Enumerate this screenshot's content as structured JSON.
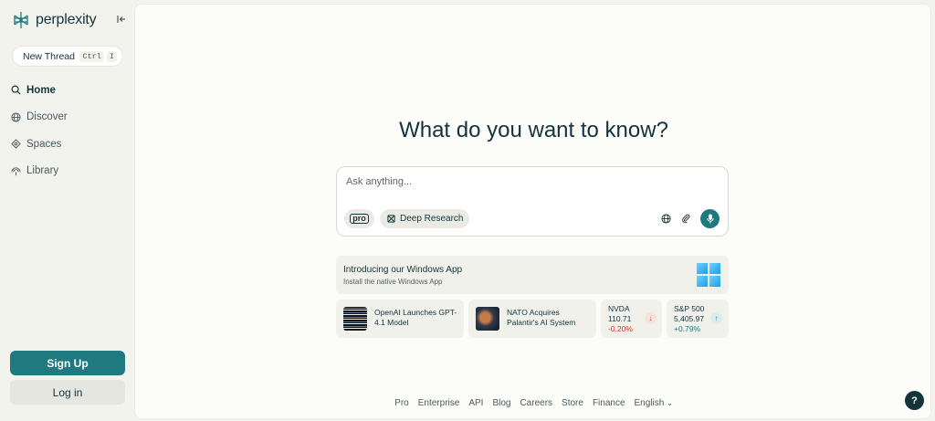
{
  "app": {
    "name": "perplexity"
  },
  "sidebar": {
    "new_thread": {
      "label": "New Thread",
      "shortcut_key1": "Ctrl",
      "shortcut_key2": "I"
    },
    "nav": [
      {
        "label": "Home",
        "icon": "search-icon",
        "active": true
      },
      {
        "label": "Discover",
        "icon": "globe-icon",
        "active": false
      },
      {
        "label": "Spaces",
        "icon": "spaces-icon",
        "active": false
      },
      {
        "label": "Library",
        "icon": "library-icon",
        "active": false
      }
    ],
    "sign_up": "Sign Up",
    "log_in": "Log in"
  },
  "main": {
    "headline": "What do you want to know?",
    "search": {
      "placeholder": "Ask anything...",
      "pro_label": "pro",
      "deep_research": "Deep Research"
    },
    "banner": {
      "title": "Introducing our Windows App",
      "subtitle": "Install the native Windows App"
    },
    "news": [
      {
        "title": "OpenAI Launches GPT-4.1 Model"
      },
      {
        "title": "NATO Acquires Palantir's AI System"
      }
    ],
    "stocks": [
      {
        "symbol": "NVDA",
        "price": "110.71",
        "change": "-0.20%",
        "direction": "down",
        "color": "#c0392b"
      },
      {
        "symbol": "S&P 500",
        "price": "5,405.97",
        "change": "+0.79%",
        "direction": "up",
        "color": "#1f7a80"
      }
    ],
    "footer": [
      "Pro",
      "Enterprise",
      "API",
      "Blog",
      "Careers",
      "Store",
      "Finance"
    ],
    "language": "English",
    "help": "?"
  },
  "colors": {
    "accent": "#1f7a80",
    "text": "#13343b",
    "background": "#f3f3ee"
  }
}
